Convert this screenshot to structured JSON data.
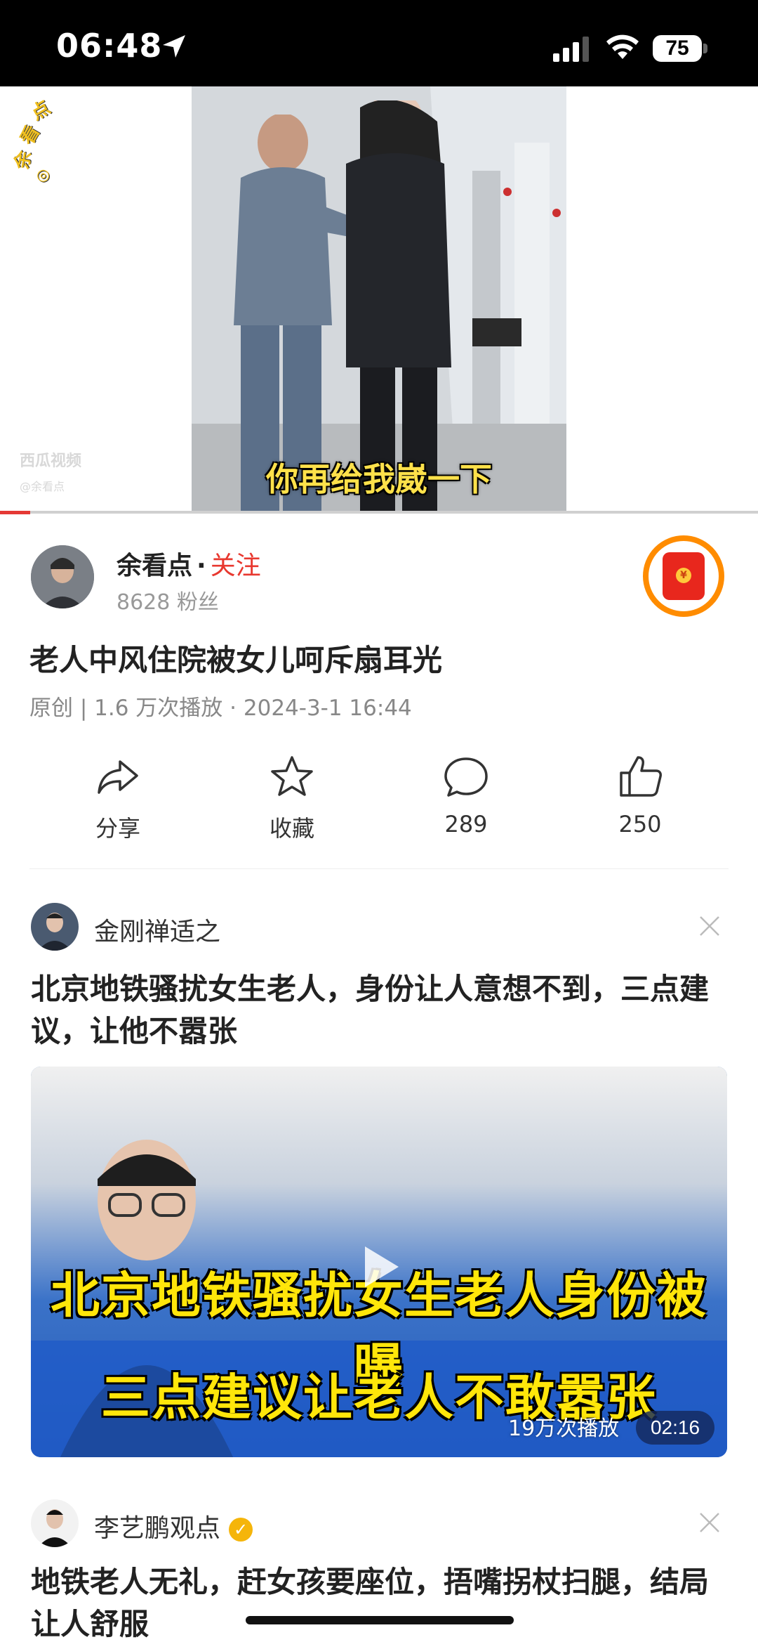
{
  "status_bar": {
    "time": "06:48",
    "battery": "75"
  },
  "video": {
    "subtitle": "你再给我崴一下",
    "watermark_logo": "余看点",
    "watermark_platform": "西瓜视频",
    "watermark_handle": "@余看点",
    "progress_fraction": 0.04
  },
  "author": {
    "name": "余看点",
    "separator": "·",
    "follow_label": "关注",
    "fans": "8628 粉丝"
  },
  "post": {
    "title": "老人中风住院被女儿呵斥扇耳光",
    "meta": "原创 | 1.6 万次播放 · 2024-3-1 16:44"
  },
  "actions": {
    "share_label": "分享",
    "favorite_label": "收藏",
    "comment_count": "289",
    "like_count": "250"
  },
  "feed": [
    {
      "author": "金刚禅适之",
      "title": "北京地铁骚扰女生老人，身份让人意想不到，三点建议，让他不嚣张",
      "thumb_text_1": "北京地铁骚扰女生老人身份被曝",
      "thumb_text_2": "三点建议让老人不敢嚣张",
      "views": "19万次播放",
      "duration": "02:16"
    },
    {
      "author": "李艺鹏观点",
      "title": "地铁老人无礼，赶女孩要座位，捂嘴拐杖扫腿，结局让人舒服"
    }
  ],
  "colors": {
    "accent_red": "#e8382f",
    "redpacket_ring": "#ff8c00",
    "subtitle_yellow": "#ffe14a"
  }
}
